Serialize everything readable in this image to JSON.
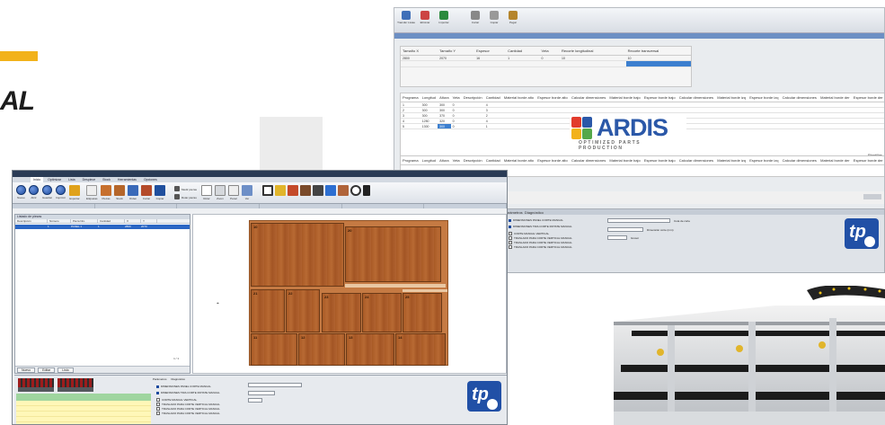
{
  "brand": {
    "text": "AL"
  },
  "ardis_logo": {
    "name": "ARDIS",
    "tagline": "OPTIMIZED PARTS PRODUCTION",
    "colors": [
      "#e23b2c",
      "#2b58a8",
      "#f2b21b",
      "#55a84a"
    ]
  },
  "back_window": {
    "toolbar": [
      "Transfer Listas",
      "Eliminar",
      "Importar",
      "Cortar",
      "Copiar",
      "Pegar"
    ],
    "panel_columns": [
      "Tamaño X",
      "Tamaño Y",
      "Espesor",
      "Cantidad",
      "Veta",
      "Recorte longitudinal",
      "Recorte transversal"
    ],
    "panel_row": [
      "2800",
      "2070",
      "16",
      "1",
      "0",
      "10",
      "10"
    ],
    "table_columns": [
      "Programa",
      "Longitud",
      "Altura",
      "Veta",
      "Descripción",
      "Cantidad",
      "Material borde alto",
      "Espesor borde alto",
      "Calcular dimensiones",
      "Material borde bajo",
      "Espesor borde bajo",
      "Calcular dimensiones",
      "Material borde izq",
      "Espesor borde izq",
      "Calcular dimensiones",
      "Material borde der",
      "Espesor borde der"
    ],
    "rows": [
      [
        "1",
        "300",
        "300",
        "0",
        "",
        "4"
      ],
      [
        "2",
        "300",
        "300",
        "0",
        "",
        "3"
      ],
      [
        "3",
        "300",
        "370",
        "0",
        "",
        "2"
      ],
      [
        "4",
        "1250",
        "320",
        "0",
        "",
        "4"
      ],
      [
        "5",
        "1300",
        "300",
        "0",
        "",
        "1"
      ]
    ],
    "section_label": "Plantillas",
    "table2_columns": [
      "Programa",
      "Longitud",
      "Altura",
      "Veta",
      "Descripción",
      "Cantidad",
      "Material borde alto",
      "Espesor borde alto",
      "Calcular dimensiones",
      "Material borde bajo",
      "Espesor borde bajo",
      "Calcular dimensiones",
      "Material borde izq",
      "Espesor borde izq",
      "Calcular dimensiones",
      "Material borde der",
      "Espesor borde der"
    ]
  },
  "mid_panel": {
    "tabs": [
      "Parámetros",
      "Diagnóstico"
    ],
    "options": [
      "DIMENSIONES PANEL CORTE MANUAL",
      "DIMENSIONES TIRA CORTE ROTATE MANUAL",
      "CORTE MANUAL VERTICAL",
      "TRASLADO PARA CORTE VERTICAL MANUAL",
      "TRASLADO PARA CORTE VERTICAL MANUAL",
      "TRASLADO PARA CORTE VERTICAL MANUAL"
    ],
    "right_labels": [
      "Cota de corte",
      "Dimensión corte (mm)",
      "Grosor"
    ]
  },
  "main_window": {
    "ribbon_tabs": [
      "Inicio",
      "Optimizar",
      "Lista",
      "Despiece",
      "Stock",
      "Herramientas",
      "Opciones"
    ],
    "buttons": [
      "Nuevo",
      "Abrir",
      "Guardar",
      "Imprimir",
      "Exportar",
      "Etiquetas",
      "Piezas",
      "Stock",
      "Orden",
      "Cortar",
      "Copiar",
      "Pegar",
      "Medir piezas",
      "Rotar piezas",
      "Rotar",
      "Zoom",
      "Panel",
      "Ver"
    ],
    "left_pane": {
      "title": "Listado de piezas",
      "columns": [
        "Descripción",
        "Número",
        "Pieza Nro.",
        "Cantidad",
        "X",
        "Y"
      ],
      "selected_row": [
        "",
        "1",
        "PANEL 1",
        "1",
        "2800",
        "2070"
      ],
      "footer_buttons": [
        "Nuevo",
        "Editar",
        "Listo"
      ],
      "count": "1 / 1"
    },
    "pieces": [
      "10",
      "20",
      "21",
      "22",
      "23",
      "24",
      "25",
      "26",
      "11",
      "12",
      "13",
      "14"
    ],
    "bottom_options": [
      "DIMENSIONES PANEL CORTE MANUAL",
      "DIMENSIONES TIRA CORTE ROTATE MANUAL",
      "CORTE MANUAL VERTICAL",
      "TRASLADO PARA CORTE VERTICAL MANUAL",
      "TRASLADO PARA CORTE VERTICAL MANUAL",
      "TRASLADO PARA CORTE VERTICAL MANUAL"
    ],
    "bottom_tabs": [
      "Parámetros",
      "Diagnóstico"
    ]
  }
}
